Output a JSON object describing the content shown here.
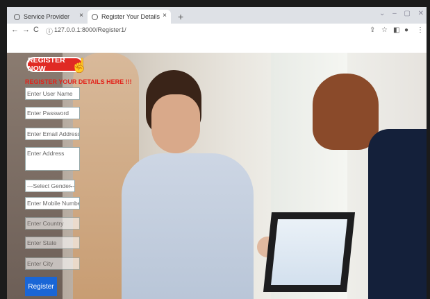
{
  "browser": {
    "tabs": [
      {
        "label": "Service Provider",
        "close": "×"
      },
      {
        "label": "Register Your Details",
        "close": "×"
      }
    ],
    "new_tab": "+",
    "url": "127.0.0.1:8000/Register1/"
  },
  "page": {
    "register_now": "REGISTER NOW",
    "subtitle": "REGISTER YOUR DETAILS HERE !!!",
    "fields": {
      "username": "Enter User Name",
      "password": "Enter Password",
      "email": "Enter Email Address",
      "address": "Enter Address",
      "gender": "---Select Gender---",
      "mobile": "Enter Mobile Number",
      "country": "Enter Country",
      "state": "Enter State",
      "city": "Enter City"
    },
    "register_button": "Register"
  }
}
